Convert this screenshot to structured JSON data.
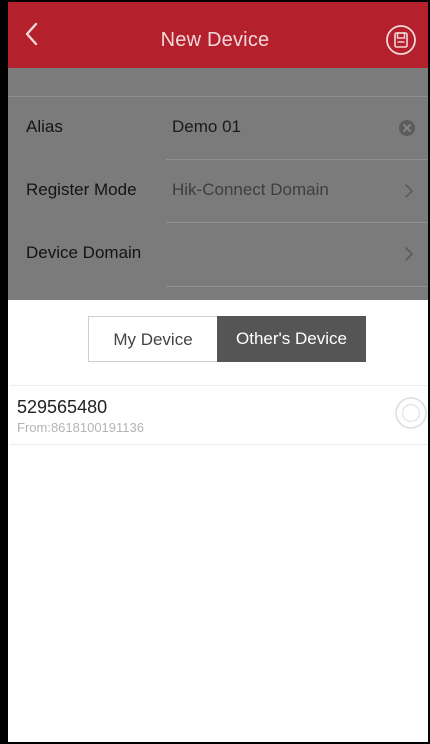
{
  "header": {
    "title": "New Device",
    "background": "#b4202c",
    "back_icon": "chevron-left-icon",
    "save_icon": "save-device-icon"
  },
  "form": {
    "rows": [
      {
        "label": "Alias",
        "value": "Demo 01",
        "action_icon": "clear-circle-icon"
      },
      {
        "label": "Register Mode",
        "value": "Hik-Connect Domain",
        "action_icon": "chevron-right-icon"
      },
      {
        "label": "Device Domain",
        "value": "",
        "action_icon": "chevron-right-icon"
      }
    ]
  },
  "tabs": {
    "items": [
      "My Device",
      "Other's Device"
    ],
    "selected": "Other's Device",
    "selected_color": "#555555"
  },
  "devices": [
    {
      "serial": "529565480",
      "source": "From:8618100191136",
      "selected": false
    }
  ]
}
